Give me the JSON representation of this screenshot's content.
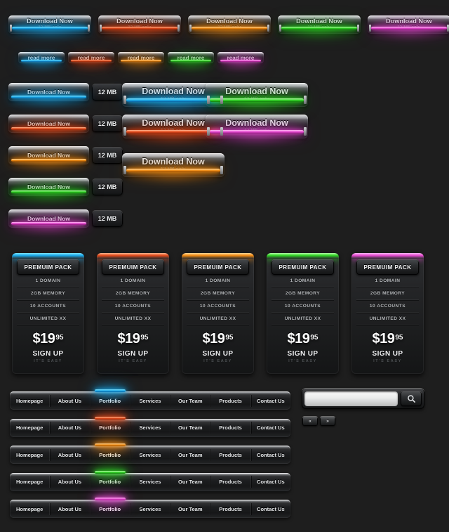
{
  "background_color": "#1e1e1e",
  "palette": {
    "blue": {
      "name": "blue",
      "core": "#7fe3ff",
      "mid": "#19a8e8",
      "deep": "#0a5f9a"
    },
    "red": {
      "name": "red",
      "core": "#ffb690",
      "mid": "#e2491a",
      "deep": "#8a2408"
    },
    "amber": {
      "name": "amber",
      "core": "#ffd79a",
      "mid": "#f08a12",
      "deep": "#8d4a02"
    },
    "green": {
      "name": "green",
      "core": "#b6ffa8",
      "mid": "#2fd224",
      "deep": "#137a0c"
    },
    "magenta": {
      "name": "magenta",
      "core": "#ffb8f3",
      "mid": "#e449cf",
      "deep": "#8a1577"
    }
  },
  "download_wide": {
    "label": "Download Now",
    "sublabel": "12 MB only",
    "variants": [
      "blue",
      "red",
      "amber",
      "green",
      "magenta"
    ]
  },
  "read_more": {
    "label": "read more",
    "variants": [
      "blue",
      "red",
      "amber",
      "green",
      "magenta"
    ]
  },
  "download_split": {
    "label": "Download Now",
    "badge": "12 MB",
    "variants": [
      "blue",
      "red",
      "amber",
      "green",
      "magenta"
    ]
  },
  "download_medium": {
    "label": "Download Now",
    "sublabel": "12 MB only",
    "variants": [
      "blue",
      "red",
      "amber",
      "green",
      "magenta"
    ]
  },
  "pricing": {
    "header": "PREMUIM PACK",
    "features": [
      "1 DOMAIN",
      "2GB MEMORY",
      "10 ACCOUNTS",
      "UNLIMITED XX"
    ],
    "price_currency": "$",
    "price_whole": "19",
    "price_cents": "95",
    "cta": "SIGN UP",
    "cta_sub": "IT'S EASY",
    "variants": [
      "blue",
      "red",
      "amber",
      "green",
      "magenta"
    ]
  },
  "nav": {
    "items": [
      "Homepage",
      "About Us",
      "Portfolio",
      "Services",
      "Our Team",
      "Products",
      "Contact Us"
    ],
    "active_index": 2,
    "variants": [
      "blue",
      "red",
      "amber",
      "green",
      "magenta"
    ]
  },
  "search": {
    "value": "",
    "placeholder": "",
    "icon": "magnifier-icon"
  },
  "pager": {
    "prev_label": "«",
    "next_label": "»"
  }
}
